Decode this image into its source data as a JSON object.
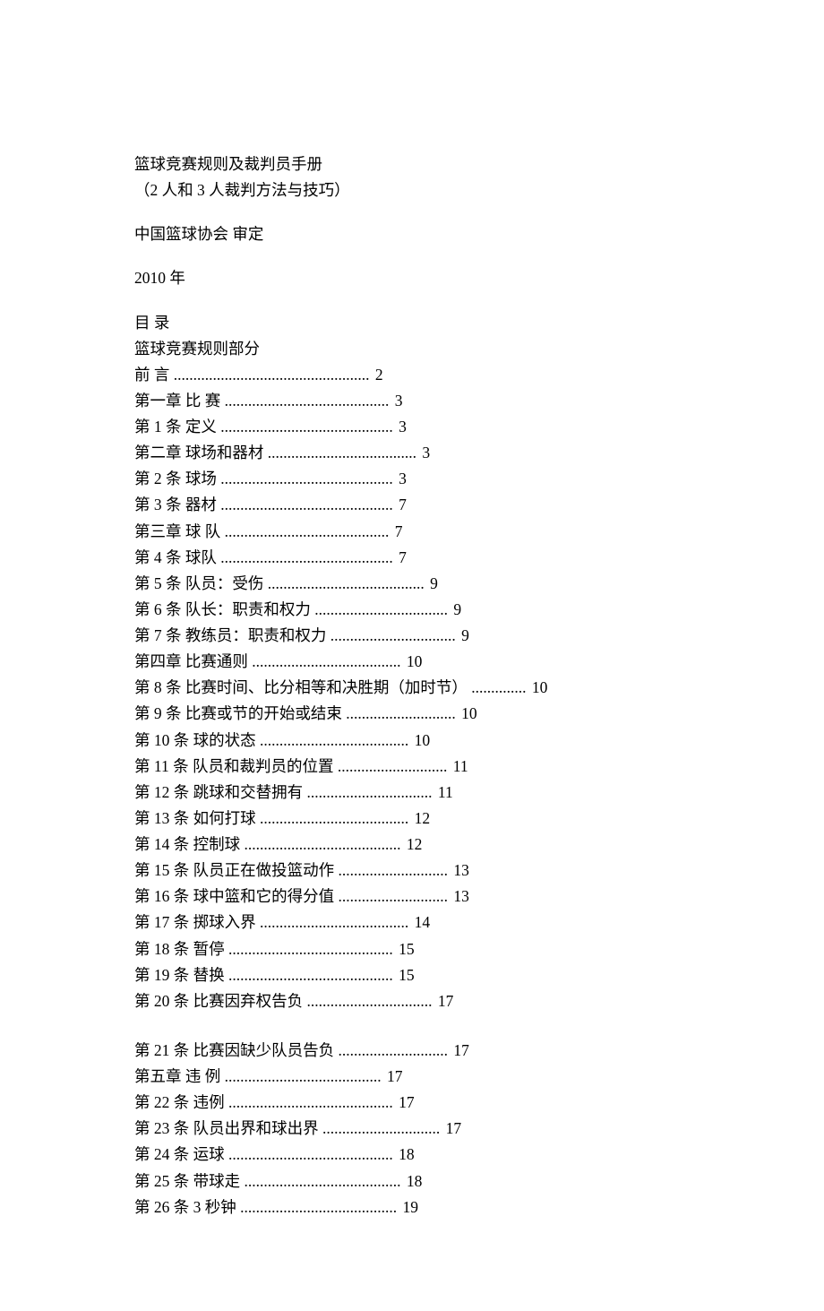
{
  "title": "篮球竞赛规则及裁判员手册",
  "subtitle": "（2 人和 3 人裁判方法与技巧）",
  "approval": "中国篮球协会  审定",
  "year": "2010 年",
  "toc_heading": "目  录",
  "toc_section": "篮球竞赛规则部分",
  "entries": [
    {
      "label": "前  言",
      "page": "2",
      "dots": 50
    },
    {
      "label": "第一章  比  赛",
      "page": "3",
      "dots": 42
    },
    {
      "label": "第 1 条  定义",
      "page": "3",
      "dots": 44
    },
    {
      "label": "第二章  球场和器材",
      "page": "3",
      "dots": 38
    },
    {
      "label": "第 2 条  球场",
      "page": "3",
      "dots": 44
    },
    {
      "label": "第 3 条  器材",
      "page": "7",
      "dots": 44
    },
    {
      "label": "第三章  球  队",
      "page": "7",
      "dots": 42
    },
    {
      "label": "第 4 条  球队",
      "page": "7",
      "dots": 44
    },
    {
      "label": "第 5 条  队员：受伤",
      "page": "9",
      "dots": 40
    },
    {
      "label": "第 6 条  队长：职责和权力",
      "page": "9",
      "dots": 34
    },
    {
      "label": "第 7 条  教练员：职责和权力",
      "page": "9",
      "dots": 32
    },
    {
      "label": "第四章  比赛通则",
      "page": "10",
      "dots": 38
    },
    {
      "label": "第 8 条  比赛时间、比分相等和决胜期（加时节）",
      "page": "10",
      "dots": 14
    },
    {
      "label": "第 9 条  比赛或节的开始或结束",
      "page": "10",
      "dots": 28
    },
    {
      "label": "第 10 条  球的状态",
      "page": "10",
      "dots": 38
    },
    {
      "label": "第 11 条  队员和裁判员的位置",
      "page": "11",
      "dots": 28
    },
    {
      "label": "第 12 条  跳球和交替拥有",
      "page": "11",
      "dots": 32
    },
    {
      "label": "第 13 条  如何打球",
      "page": "12",
      "dots": 38
    },
    {
      "label": "第 14 条  控制球",
      "page": "12",
      "dots": 40
    },
    {
      "label": "第 15 条  队员正在做投篮动作",
      "page": "13",
      "dots": 28
    },
    {
      "label": "第 16 条  球中篮和它的得分值",
      "page": "13",
      "dots": 28
    },
    {
      "label": "第 17 条  掷球入界",
      "page": "14",
      "dots": 38
    },
    {
      "label": "第 18 条  暂停",
      "page": "15",
      "dots": 42
    },
    {
      "label": "第 19 条  替换",
      "page": "15",
      "dots": 42
    },
    {
      "label": "第 20 条  比赛因弃权告负",
      "page": "17",
      "dots": 32
    },
    {
      "gap": true
    },
    {
      "label": "第 21 条  比赛因缺少队员告负",
      "page": "17",
      "dots": 28
    },
    {
      "label": "第五章  违  例",
      "page": "17",
      "dots": 40
    },
    {
      "label": "第 22 条  违例",
      "page": "17",
      "dots": 42
    },
    {
      "label": "第 23 条  队员出界和球出界",
      "page": "17",
      "dots": 30
    },
    {
      "label": "第 24 条  运球",
      "page": "18",
      "dots": 42
    },
    {
      "label": "第 25 条  带球走",
      "page": "18",
      "dots": 40
    },
    {
      "label": "第 26 条  3 秒钟",
      "page": "19",
      "dots": 40
    }
  ]
}
